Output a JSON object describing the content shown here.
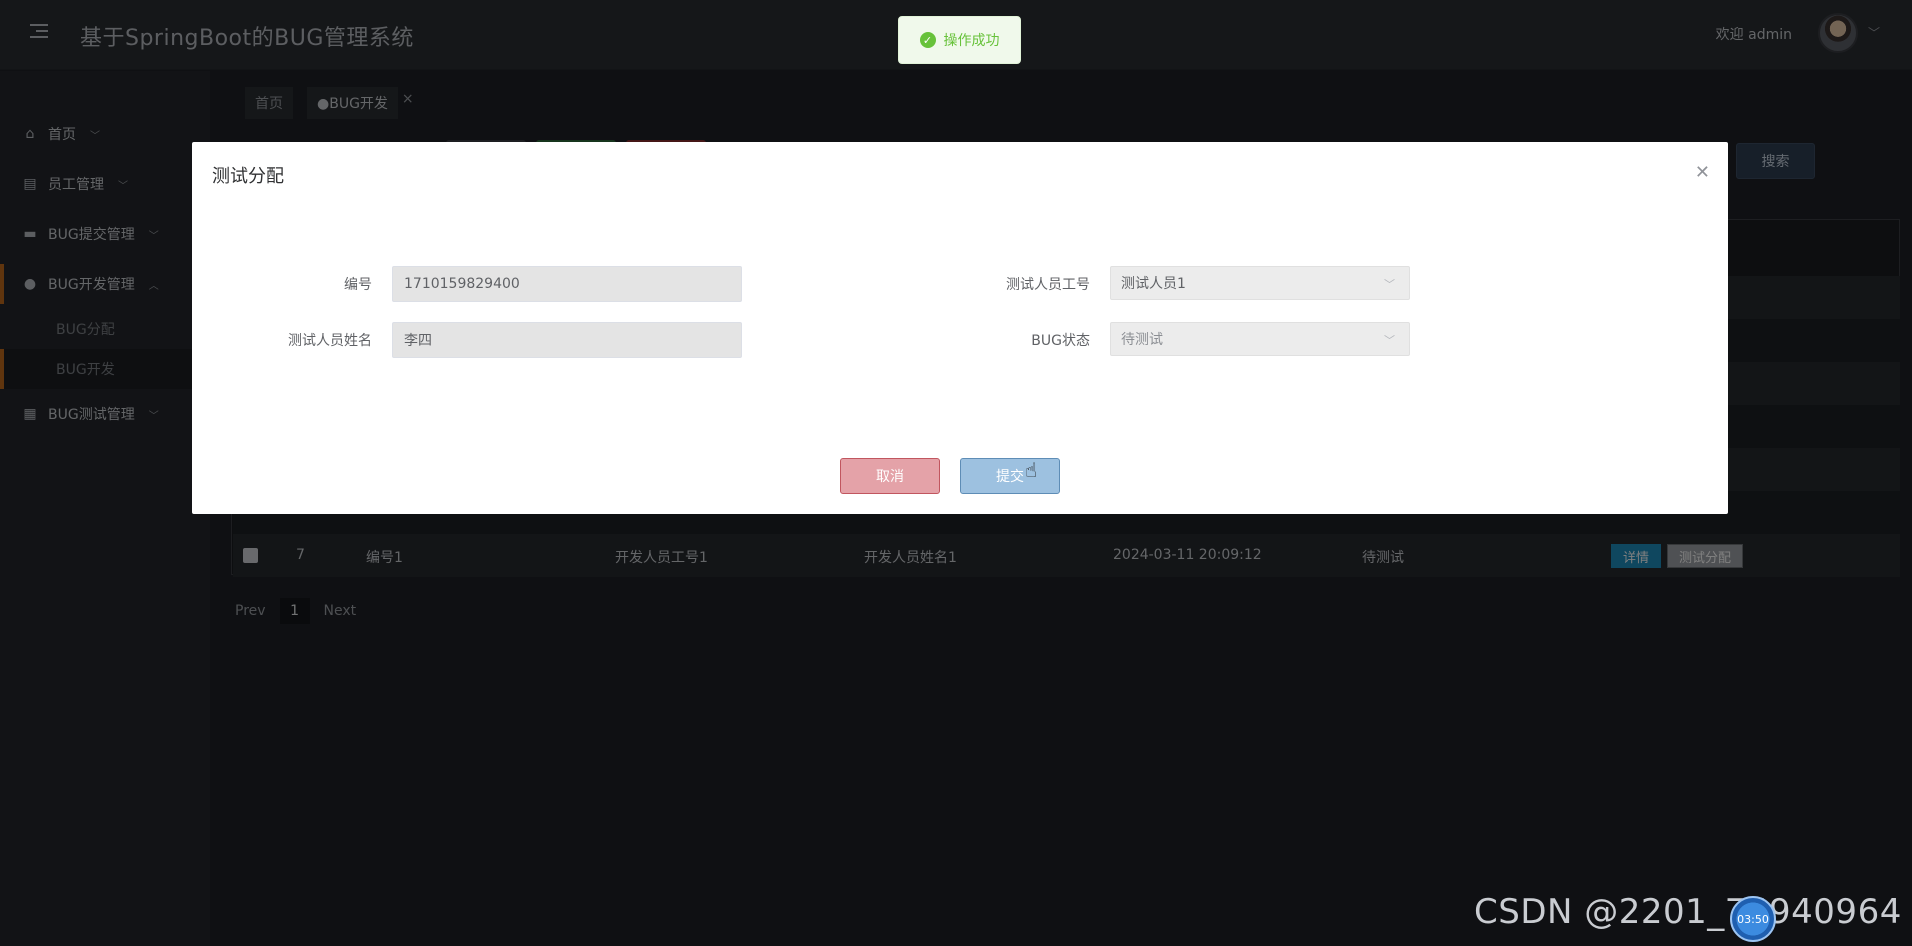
{
  "header": {
    "title": "基于SpringBoot的BUG管理系统",
    "welcome": "欢迎 admin"
  },
  "toast": {
    "message": "操作成功"
  },
  "sidebar": {
    "items": [
      {
        "label": "首页",
        "icon": "home-icon"
      },
      {
        "label": "员工管理",
        "icon": "table-icon"
      },
      {
        "label": "BUG提交管理",
        "icon": "upload-icon"
      },
      {
        "label": "BUG开发管理",
        "icon": "drop-icon"
      },
      {
        "label": "BUG测试管理",
        "icon": "chart-icon"
      }
    ],
    "sub_items": [
      {
        "label": "BUG分配"
      },
      {
        "label": "BUG开发"
      }
    ]
  },
  "breadcrumb": {
    "home": "首页",
    "current": "●BUG开发"
  },
  "toolbar": {
    "search_label": "搜索"
  },
  "table": {
    "rows": [
      {
        "index": "7",
        "code": "编号1",
        "dev_id": "开发人员工号1",
        "dev_name": "开发人员姓名1",
        "time": "2024-03-11 20:09:12",
        "status": "待测试"
      }
    ],
    "detail_label": "详情",
    "assign_label": "测试分配"
  },
  "pager": {
    "prev": "Prev",
    "page": "1",
    "next": "Next"
  },
  "modal": {
    "title": "测试分配",
    "fields": {
      "code_label": "编号",
      "code_value": "1710159829400",
      "tester_id_label": "测试人员工号",
      "tester_id_value": "测试人员1",
      "tester_name_label": "测试人员姓名",
      "tester_name_value": "李四",
      "status_label": "BUG状态",
      "status_value": "待测试"
    },
    "cancel_label": "取消",
    "submit_label": "提交"
  },
  "watermark": {
    "text": "CSDN @2201_75940964",
    "badge": "03:50"
  }
}
